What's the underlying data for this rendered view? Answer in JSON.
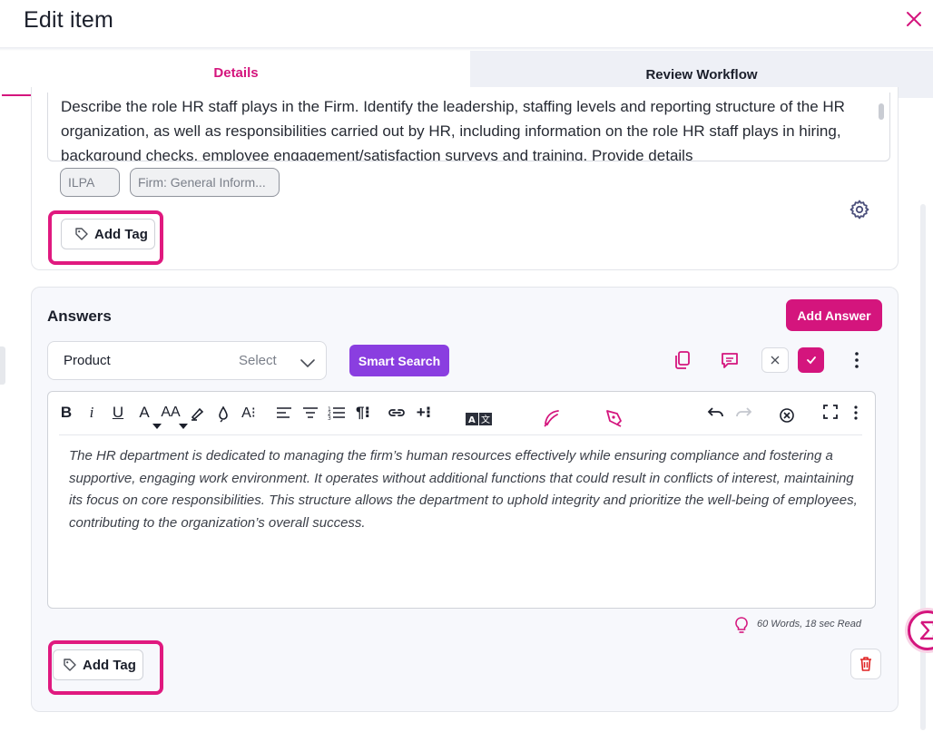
{
  "header": {
    "title": "Edit item"
  },
  "tabs": [
    {
      "label": "Details",
      "active": true
    },
    {
      "label": "Review Workflow",
      "active": false
    }
  ],
  "question": {
    "text": "Describe the role HR staff plays in the Firm. Identify the leadership, staffing levels and reporting structure of the HR organization, as well as responsibilities carried out by HR, including information on the role HR staff plays in hiring, background checks, employee engagement/satisfaction surveys and training. Provide details",
    "tags": [
      "ILPA",
      "Firm: General Inform..."
    ],
    "add_tag_label": "Add Tag"
  },
  "answers": {
    "title": "Answers",
    "add_answer_label": "Add Answer",
    "product_label": "Product",
    "product_select": "Select",
    "smart_search_label": "Smart Search",
    "answer_text": "The HR department is dedicated to managing the firm’s human resources effectively while ensuring compliance and fostering a supportive, engaging work environment. It operates without additional functions that could result in conflicts of interest, maintaining its focus on core responsibilities. This structure allows the department to uphold integrity and prioritize the well-being of employees, contributing to the organization’s overall success.",
    "word_count": "60 Words, 18 sec Read",
    "add_tag_label": "Add Tag"
  },
  "toolbar": {
    "bold": "B",
    "italic": "i",
    "underline": "U",
    "font_color": "A",
    "font_size": "AA",
    "line_height": "A⁝",
    "paragraph": "¶⁝",
    "insert_more": "+⁝"
  },
  "colors": {
    "accent": "#d4157d",
    "smart_search": "#8a3ee0",
    "tab_inactive_bg": "#eef0f6"
  },
  "icons": [
    "close-icon",
    "gear-icon",
    "tag-icon",
    "chevron-down-icon",
    "copy-icon",
    "comment-icon",
    "x-icon",
    "check-icon",
    "more-vertical-icon",
    "undo-icon",
    "redo-icon",
    "clear-format-icon",
    "fullscreen-icon",
    "translate-icon",
    "feather-icon",
    "pen-icon",
    "bulb-icon",
    "trash-icon",
    "sigma-icon"
  ]
}
